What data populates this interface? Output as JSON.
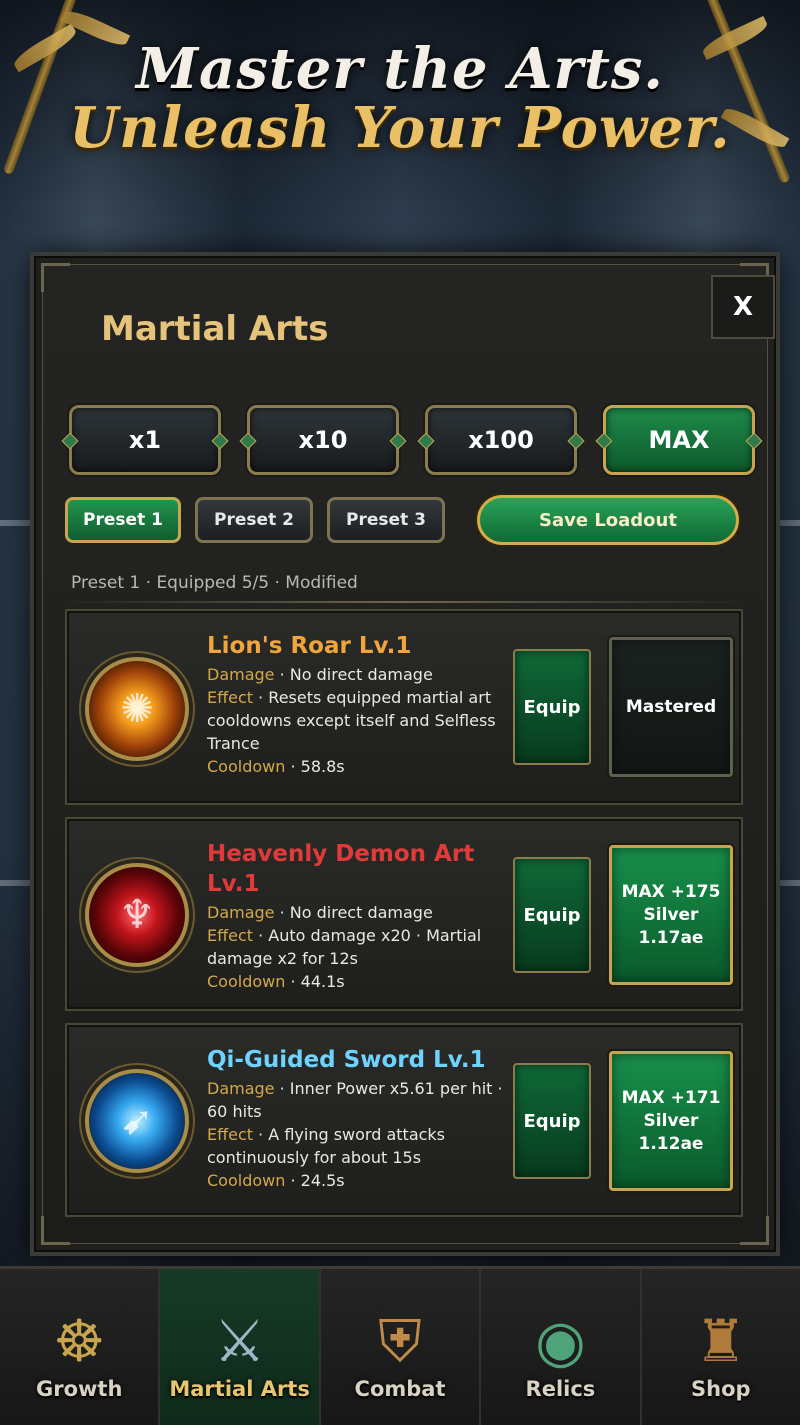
{
  "banner": {
    "line1": "Master the Arts.",
    "line2": "Unleash Your Power."
  },
  "panel": {
    "title": "Martial Arts",
    "close_label": "X",
    "multipliers": [
      {
        "label": "x1",
        "active": false
      },
      {
        "label": "x10",
        "active": false
      },
      {
        "label": "x100",
        "active": false
      },
      {
        "label": "MAX",
        "active": true
      }
    ],
    "presets": [
      {
        "label": "Preset 1",
        "active": true
      },
      {
        "label": "Preset 2",
        "active": false
      },
      {
        "label": "Preset 3",
        "active": false
      }
    ],
    "save_label": "Save Loadout",
    "status": "Preset 1 · Equipped 5/5 · Modified"
  },
  "skills": [
    {
      "name": "Lion's Roar Lv.1",
      "damage_label": "Damage",
      "damage": " · No direct damage",
      "effect_label": "Effect",
      "effect": " · Resets equipped martial art cooldowns except itself and Selfless Trance",
      "cooldown_label": "Cooldown",
      "cooldown": " · 58.8s",
      "equip_label": "Equip",
      "upgrade_label": "Mastered",
      "icon": "lion-fire-icon"
    },
    {
      "name": "Heavenly Demon Art Lv.1",
      "damage_label": "Damage",
      "damage": " · No direct damage",
      "effect_label": "Effect",
      "effect": " · Auto damage x20 · Martial damage x2 for 12s",
      "cooldown_label": "Cooldown",
      "cooldown": " · 44.1s",
      "equip_label": "Equip",
      "upgrade_line1": "MAX +175",
      "upgrade_line2": "Silver 1.17ae",
      "icon": "demon-figure-icon"
    },
    {
      "name": "Qi-Guided Sword Lv.1",
      "damage_label": "Damage",
      "damage": " · Inner Power x5.61 per hit · 60 hits",
      "effect_label": "Effect",
      "effect": " · A flying sword attacks continuously for about 15s",
      "cooldown_label": "Cooldown",
      "cooldown": " · 24.5s",
      "equip_label": "Equip",
      "upgrade_line1": "MAX +171",
      "upgrade_line2": "Silver 1.12ae",
      "icon": "qi-sword-icon"
    }
  ],
  "nav": [
    {
      "label": "Growth",
      "icon": "meditation-icon",
      "active": false
    },
    {
      "label": "Martial Arts",
      "icon": "sword-book-icon",
      "active": true
    },
    {
      "label": "Combat",
      "icon": "crossed-swords-shield-icon",
      "active": false
    },
    {
      "label": "Relics",
      "icon": "jade-disc-icon",
      "active": false
    },
    {
      "label": "Shop",
      "icon": "treasure-bag-icon",
      "active": false
    }
  ],
  "colors": {
    "gold": "#e6c37a",
    "green_active": "#1f8a4a",
    "lions_roar": "#f2a53a",
    "heavenly_demon": "#e23a3a",
    "qi_sword": "#6ed4ff"
  }
}
